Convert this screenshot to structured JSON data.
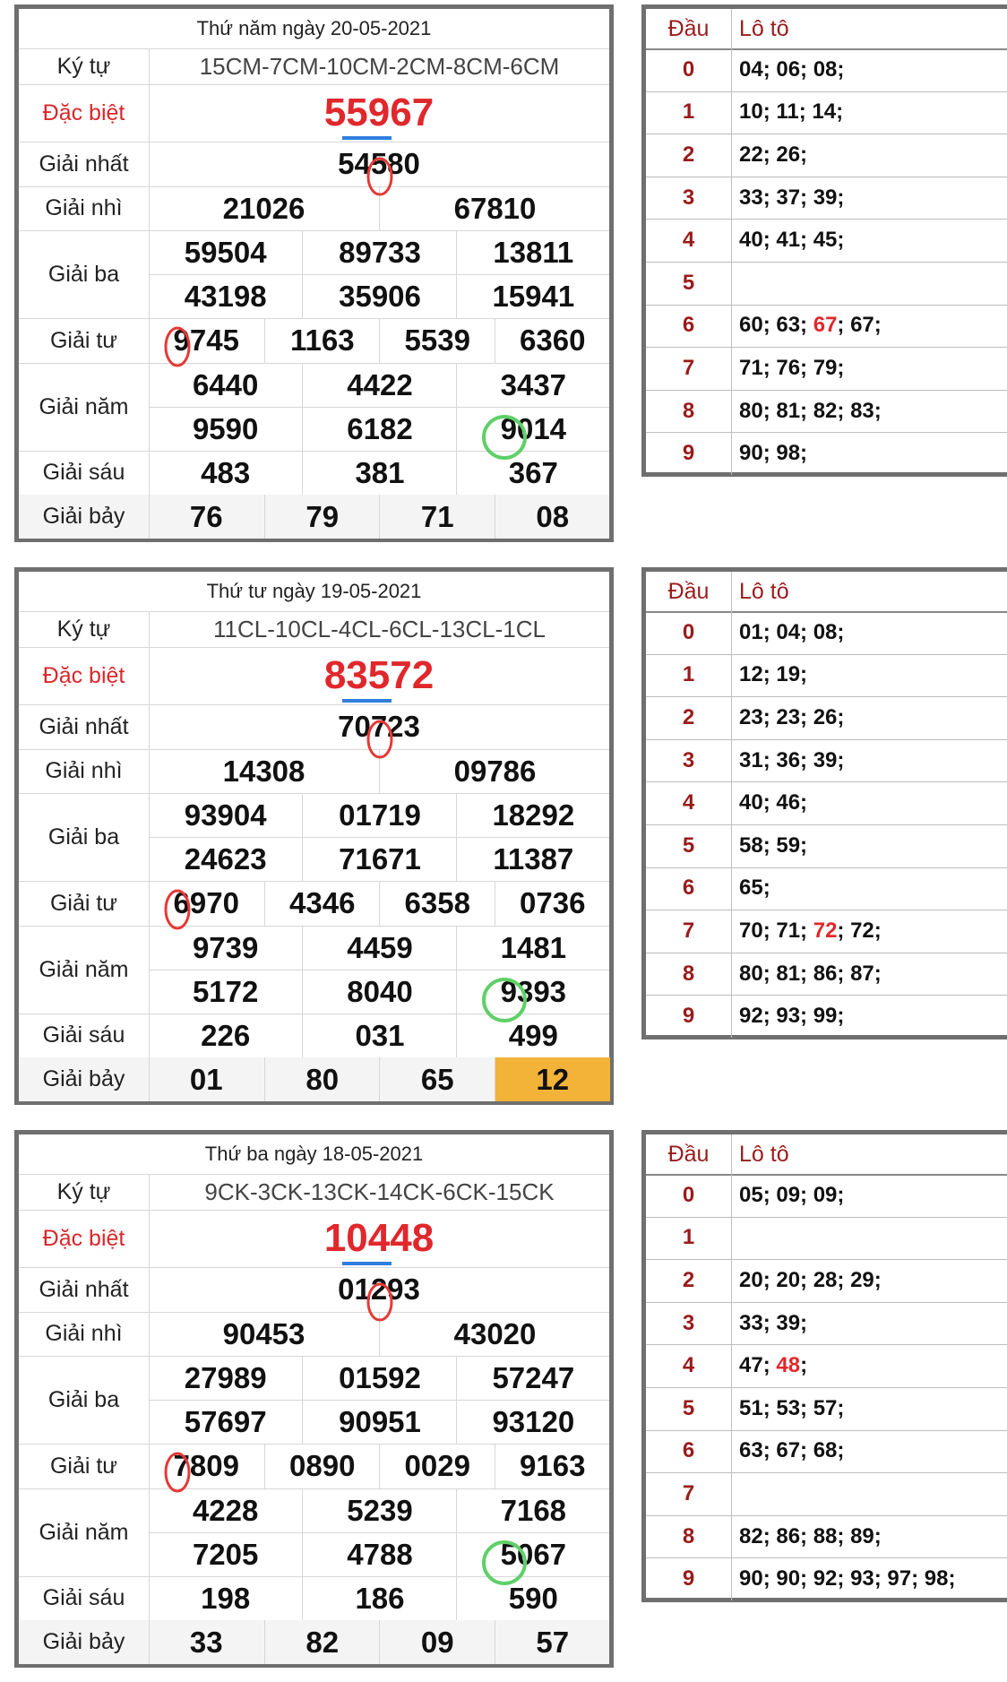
{
  "labels": {
    "ky_tu": "Ký tự",
    "dac_biet": "Đặc biệt",
    "giai_nhat": "Giải nhất",
    "giai_nhi": "Giải nhì",
    "giai_ba": "Giải ba",
    "giai_tu": "Giải tư",
    "giai_nam": "Giải năm",
    "giai_sau": "Giải sáu",
    "giai_bay": "Giải bảy",
    "dau": "Đầu",
    "loto": "Lô tô"
  },
  "days": [
    {
      "title": "Thứ năm ngày 20-05-2021",
      "ky_tu": "15CM-7CM-10CM-2CM-8CM-6CM",
      "dac_biet": "55967",
      "giai_nhat": "54580",
      "giai_nhi": [
        "21026",
        "67810"
      ],
      "giai_ba": [
        "59504",
        "89733",
        "13811",
        "43198",
        "35906",
        "15941"
      ],
      "giai_tu": [
        "9745",
        "1163",
        "5539",
        "6360"
      ],
      "giai_nam": [
        "6440",
        "4422",
        "3437",
        "9590",
        "6182",
        "9014"
      ],
      "giai_sau": [
        "483",
        "381",
        "367"
      ],
      "giai_bay": [
        "76",
        "79",
        "71",
        "08"
      ],
      "loto": [
        {
          "dau": "0",
          "pre": "04; 06; 08;",
          "hl": "",
          "post": ""
        },
        {
          "dau": "1",
          "pre": "10; 11; 14;",
          "hl": "",
          "post": ""
        },
        {
          "dau": "2",
          "pre": "22; 26;",
          "hl": "",
          "post": ""
        },
        {
          "dau": "3",
          "pre": "33; 37; 39;",
          "hl": "",
          "post": ""
        },
        {
          "dau": "4",
          "pre": "40; 41; 45;",
          "hl": "",
          "post": ""
        },
        {
          "dau": "5",
          "pre": "",
          "hl": "",
          "post": ""
        },
        {
          "dau": "6",
          "pre": "60; 63; ",
          "hl": "67",
          "post": "; 67;"
        },
        {
          "dau": "7",
          "pre": "71; 76; 79;",
          "hl": "",
          "post": ""
        },
        {
          "dau": "8",
          "pre": "80; 81; 82; 83;",
          "hl": "",
          "post": ""
        },
        {
          "dau": "9",
          "pre": "90; 98;",
          "hl": "",
          "post": ""
        }
      ]
    },
    {
      "title": "Thứ tư ngày 19-05-2021",
      "ky_tu": "11CL-10CL-4CL-6CL-13CL-1CL",
      "dac_biet": "83572",
      "giai_nhat": "70723",
      "giai_nhi": [
        "14308",
        "09786"
      ],
      "giai_ba": [
        "93904",
        "01719",
        "18292",
        "24623",
        "71671",
        "11387"
      ],
      "giai_tu": [
        "6970",
        "4346",
        "6358",
        "0736"
      ],
      "giai_nam": [
        "9739",
        "4459",
        "1481",
        "5172",
        "8040",
        "9393"
      ],
      "giai_sau": [
        "226",
        "031",
        "499"
      ],
      "giai_bay": [
        "01",
        "80",
        "65",
        "12"
      ],
      "loto": [
        {
          "dau": "0",
          "pre": "01; 04; 08;",
          "hl": "",
          "post": ""
        },
        {
          "dau": "1",
          "pre": "12; 19;",
          "hl": "",
          "post": ""
        },
        {
          "dau": "2",
          "pre": "23; 23; 26;",
          "hl": "",
          "post": ""
        },
        {
          "dau": "3",
          "pre": "31; 36; 39;",
          "hl": "",
          "post": ""
        },
        {
          "dau": "4",
          "pre": "40; 46;",
          "hl": "",
          "post": ""
        },
        {
          "dau": "5",
          "pre": "58; 59;",
          "hl": "",
          "post": ""
        },
        {
          "dau": "6",
          "pre": "65;",
          "hl": "",
          "post": ""
        },
        {
          "dau": "7",
          "pre": "70; 71; ",
          "hl": "72",
          "post": "; 72;"
        },
        {
          "dau": "8",
          "pre": "80; 81; 86; 87;",
          "hl": "",
          "post": ""
        },
        {
          "dau": "9",
          "pre": "92; 93; 99;",
          "hl": "",
          "post": ""
        }
      ]
    },
    {
      "title": "Thứ ba ngày 18-05-2021",
      "ky_tu": "9CK-3CK-13CK-14CK-6CK-15CK",
      "dac_biet": "10448",
      "giai_nhat": "01293",
      "giai_nhi": [
        "90453",
        "43020"
      ],
      "giai_ba": [
        "27989",
        "01592",
        "57247",
        "57697",
        "90951",
        "93120"
      ],
      "giai_tu": [
        "7809",
        "0890",
        "0029",
        "9163"
      ],
      "giai_nam": [
        "4228",
        "5239",
        "7168",
        "7205",
        "4788",
        "5067"
      ],
      "giai_sau": [
        "198",
        "186",
        "590"
      ],
      "giai_bay": [
        "33",
        "82",
        "09",
        "57"
      ],
      "loto": [
        {
          "dau": "0",
          "pre": "05; 09; 09;",
          "hl": "",
          "post": ""
        },
        {
          "dau": "1",
          "pre": "",
          "hl": "",
          "post": ""
        },
        {
          "dau": "2",
          "pre": "20; 20; 28; 29;",
          "hl": "",
          "post": ""
        },
        {
          "dau": "3",
          "pre": "33; 39;",
          "hl": "",
          "post": ""
        },
        {
          "dau": "4",
          "pre": "47; ",
          "hl": "48",
          "post": ";"
        },
        {
          "dau": "5",
          "pre": "51; 53; 57;",
          "hl": "",
          "post": ""
        },
        {
          "dau": "6",
          "pre": "63; 67; 68;",
          "hl": "",
          "post": ""
        },
        {
          "dau": "7",
          "pre": "",
          "hl": "",
          "post": ""
        },
        {
          "dau": "8",
          "pre": "82; 86; 88; 89;",
          "hl": "",
          "post": ""
        },
        {
          "dau": "9",
          "pre": "90; 90; 92; 93; 97; 98;",
          "hl": "",
          "post": ""
        }
      ]
    }
  ],
  "colors": {
    "special": "#e0282c",
    "label_red": "#d8272b",
    "dau_red": "#9a1b1b",
    "highlight_cell": "#f2b338",
    "red_circle": "#e53935",
    "green_circle": "#5fd068",
    "blue_underline": "#2f7fe0"
  }
}
